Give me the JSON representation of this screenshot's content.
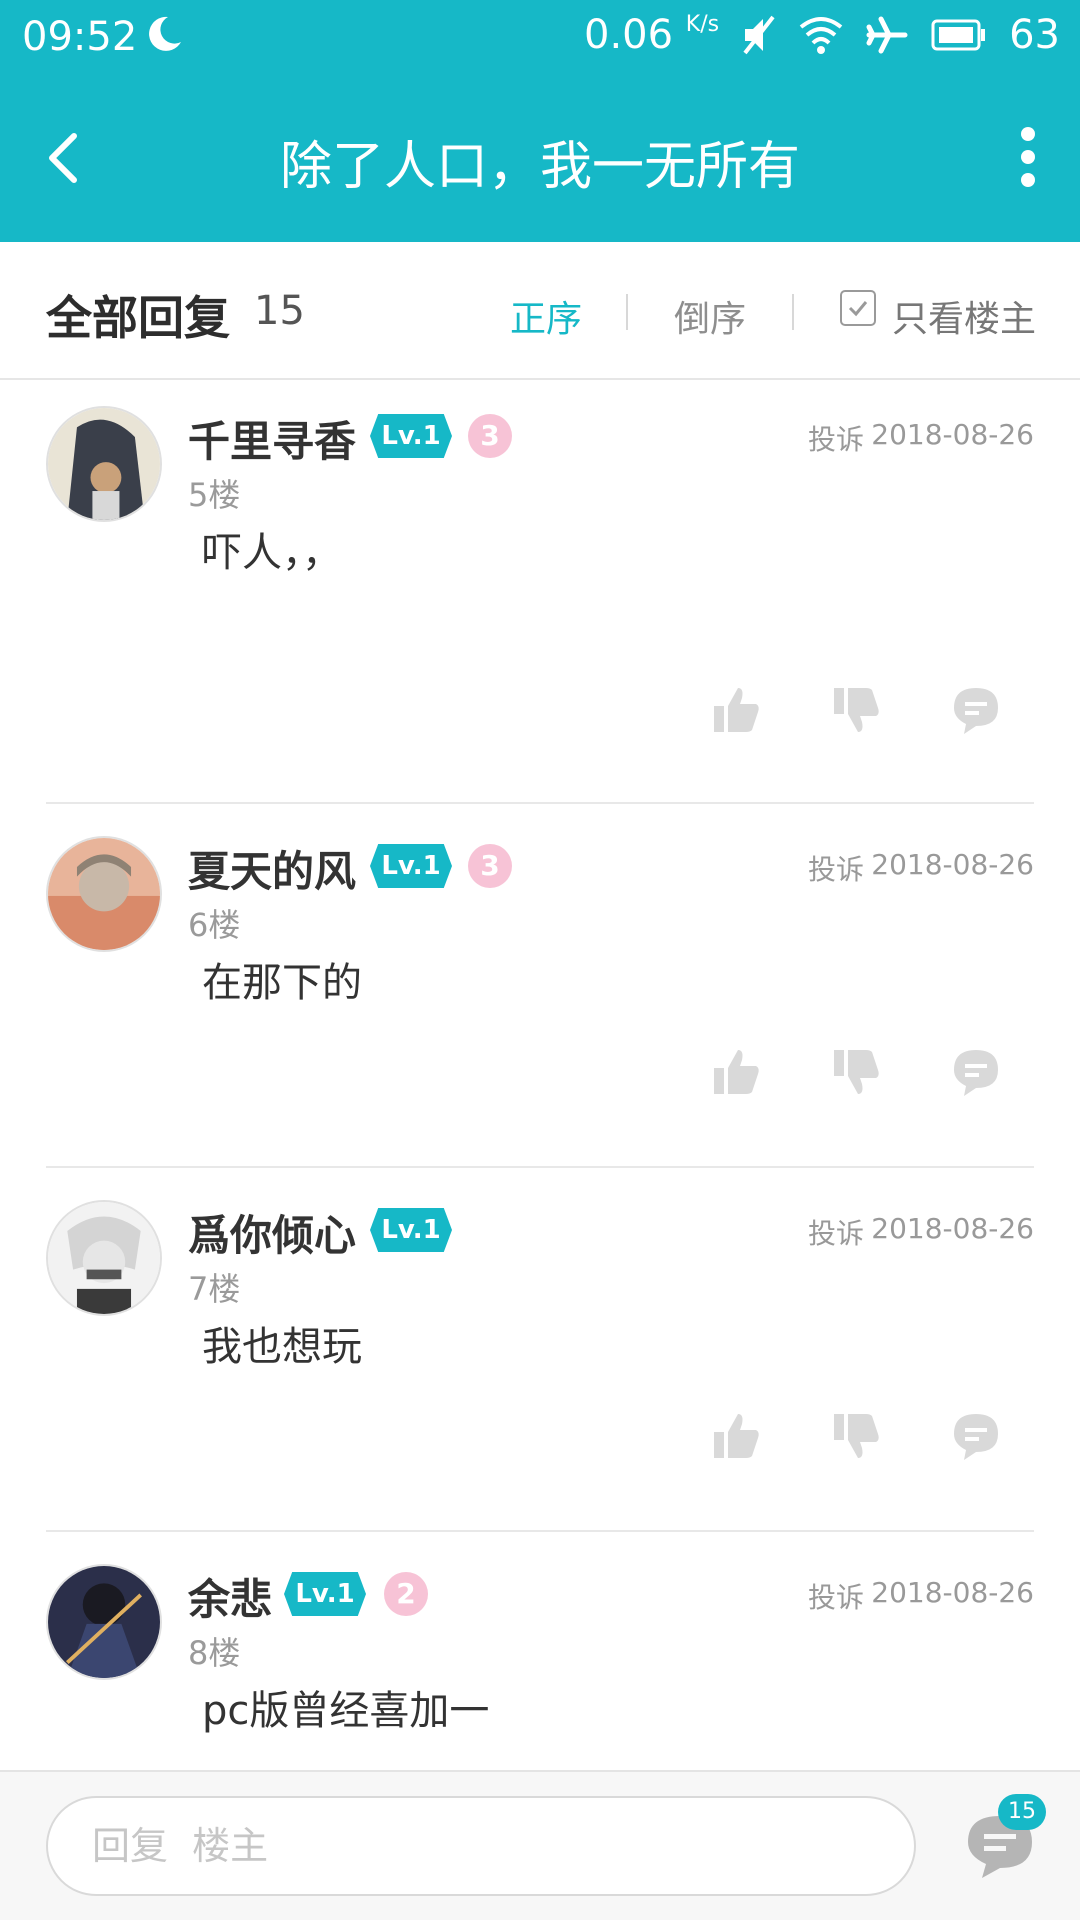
{
  "status_bar": {
    "time": "09:52",
    "speed": "0.06",
    "speed_unit": "K/s",
    "battery": "63",
    "icons": [
      "moon-icon",
      "mute-icon",
      "wifi-icon",
      "airplane-icon",
      "battery-icon"
    ]
  },
  "header": {
    "title": "除了人口，我一无所有",
    "back_icon": "back-arrow-icon",
    "more_icon": "more-vertical-icon",
    "color": "#16b8c7"
  },
  "filter": {
    "all_label": "全部回复",
    "count": "15",
    "order_asc": "正序",
    "order_desc": "倒序",
    "only_op": "只看楼主",
    "active": "正序"
  },
  "posts": [
    {
      "name": "千里寻香",
      "level": "Lv.1",
      "medal": "3",
      "complain": "投诉",
      "date": "2018-08-26",
      "floor": "5楼",
      "content": "吓人，，"
    },
    {
      "name": "夏天的风",
      "level": "Lv.1",
      "medal": "3",
      "complain": "投诉",
      "date": "2018-08-26",
      "floor": "6楼",
      "content": "在那下的"
    },
    {
      "name": "爲你倾心",
      "level": "Lv.1",
      "medal": "",
      "complain": "投诉",
      "date": "2018-08-26",
      "floor": "7楼",
      "content": "我也想玩"
    },
    {
      "name": "余悲",
      "level": "Lv.1",
      "medal": "2",
      "complain": "投诉",
      "date": "2018-08-26",
      "floor": "8楼",
      "content": "pc版曾经喜加一"
    }
  ],
  "bottom": {
    "reply_placeholder": "回复  楼主",
    "comment_count": "15"
  }
}
